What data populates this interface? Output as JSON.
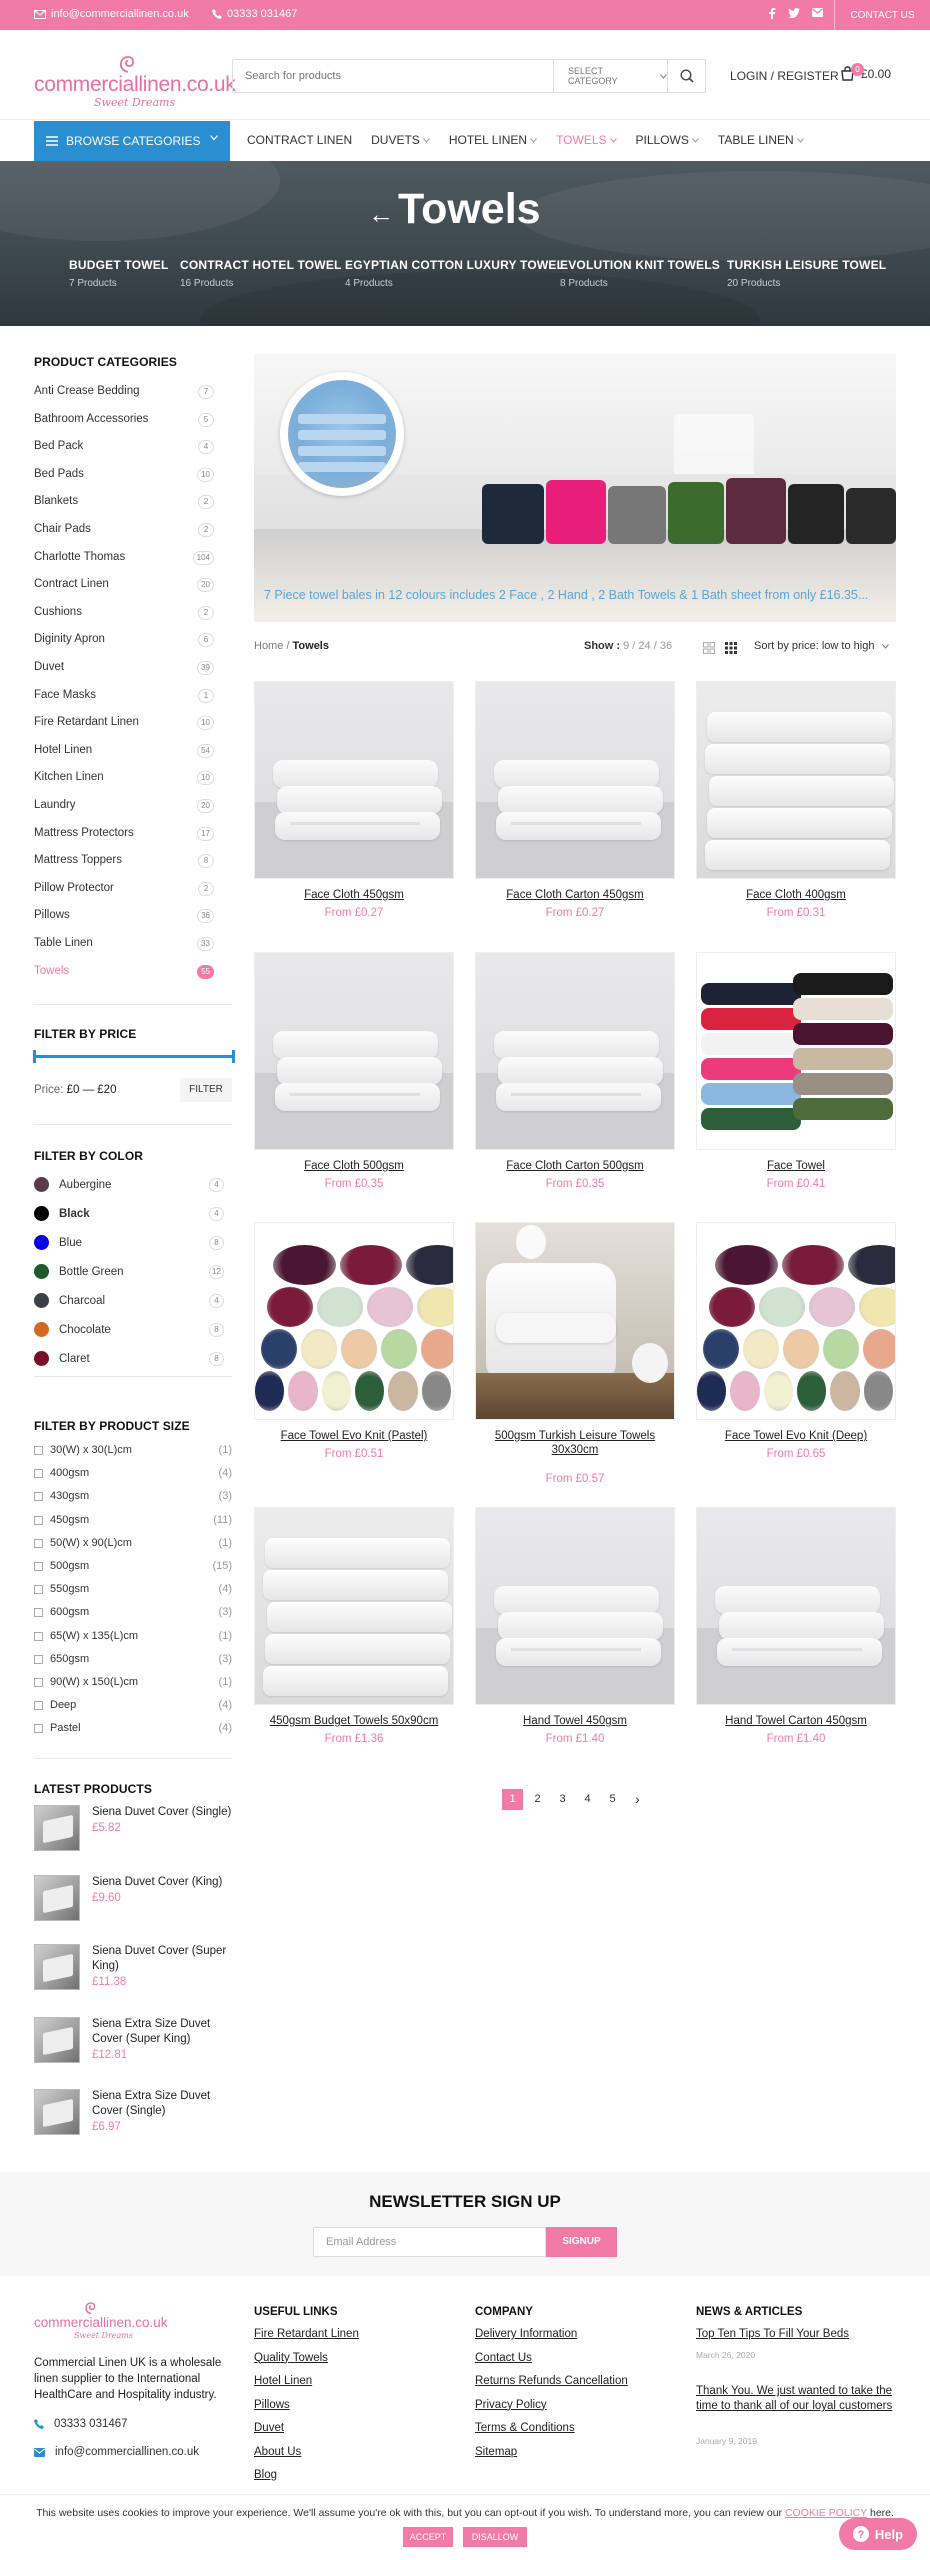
{
  "topbar": {
    "email": "info@commerciallinen.co.uk",
    "phone": "03333 031467",
    "contact": "CONTACT US",
    "social_icons": [
      "facebook-icon",
      "twitter-icon",
      "email-icon"
    ]
  },
  "header": {
    "logo_text": "commerciallinen.co.uk",
    "logo_tagline": "Sweet Dreams",
    "search_placeholder": "Search for products",
    "search_category": "SELECT CATEGORY",
    "login": "LOGIN / REGISTER",
    "cart_count": "0",
    "cart_total": "£0.00"
  },
  "nav": {
    "browse": "BROWSE CATEGORIES",
    "items": [
      {
        "label": "CONTRACT LINEN",
        "dropdown": false
      },
      {
        "label": "DUVETS",
        "dropdown": true
      },
      {
        "label": "HOTEL LINEN",
        "dropdown": true
      },
      {
        "label": "TOWELS",
        "dropdown": true,
        "active": true
      },
      {
        "label": "PILLOWS",
        "dropdown": true
      },
      {
        "label": "TABLE LINEN",
        "dropdown": true
      }
    ]
  },
  "hero": {
    "title": "Towels",
    "subcats": [
      {
        "title": "BUDGET TOWEL",
        "count": "7 Products"
      },
      {
        "title": "CONTRACT HOTEL TOWEL",
        "count": "16 Products"
      },
      {
        "title": "EGYPTIAN COTTON LUXURY TOWEL",
        "count": "4 Products"
      },
      {
        "title": "EVOLUTION KNIT TOWELS",
        "count": "8 Products"
      },
      {
        "title": "TURKISH LEISURE TOWEL",
        "count": "20 Products"
      }
    ]
  },
  "sidebar": {
    "categories_title": "PRODUCT CATEGORIES",
    "categories": [
      {
        "name": "Anti Crease Bedding",
        "count": "7"
      },
      {
        "name": "Bathroom Accessories",
        "count": "5"
      },
      {
        "name": "Bed Pack",
        "count": "4"
      },
      {
        "name": "Bed Pads",
        "count": "10"
      },
      {
        "name": "Blankets",
        "count": "2"
      },
      {
        "name": "Chair Pads",
        "count": "2"
      },
      {
        "name": "Charlotte Thomas",
        "count": "104"
      },
      {
        "name": "Contract Linen",
        "count": "20"
      },
      {
        "name": "Cushions",
        "count": "2"
      },
      {
        "name": "Diginity Apron",
        "count": "6"
      },
      {
        "name": "Duvet",
        "count": "39"
      },
      {
        "name": "Face Masks",
        "count": "1"
      },
      {
        "name": "Fire Retardant Linen",
        "count": "10"
      },
      {
        "name": "Hotel Linen",
        "count": "54"
      },
      {
        "name": "Kitchen Linen",
        "count": "10"
      },
      {
        "name": "Laundry",
        "count": "20"
      },
      {
        "name": "Mattress Protectors",
        "count": "17"
      },
      {
        "name": "Mattress Toppers",
        "count": "8"
      },
      {
        "name": "Pillow Protector",
        "count": "2"
      },
      {
        "name": "Pillows",
        "count": "36"
      },
      {
        "name": "Table Linen",
        "count": "33"
      },
      {
        "name": "Towels",
        "count": "55",
        "active": true
      }
    ],
    "price_title": "FILTER BY PRICE",
    "price_label": "Price:",
    "price_range": "£0 — £20",
    "price_button": "FILTER",
    "price_min": 0,
    "price_max": 20,
    "color_title": "FILTER BY COLOR",
    "colors": [
      {
        "name": "Aubergine",
        "count": "4",
        "hex": "#5b3a4e"
      },
      {
        "name": "Black",
        "count": "4",
        "hex": "#000000",
        "bold": true
      },
      {
        "name": "Blue",
        "count": "8",
        "hex": "#0000e6"
      },
      {
        "name": "Bottle Green",
        "count": "12",
        "hex": "#1f5a2b"
      },
      {
        "name": "Charcoal",
        "count": "4",
        "hex": "#3a3f48"
      },
      {
        "name": "Chocolate",
        "count": "8",
        "hex": "#d2691e"
      },
      {
        "name": "Claret",
        "count": "8",
        "hex": "#7a0f2a"
      }
    ],
    "size_title": "FILTER BY PRODUCT SIZE",
    "sizes": [
      {
        "name": "30(W) x 30(L)cm",
        "count": "(1)"
      },
      {
        "name": "400gsm",
        "count": "(4)"
      },
      {
        "name": "430gsm",
        "count": "(3)"
      },
      {
        "name": "450gsm",
        "count": "(11)"
      },
      {
        "name": "50(W) x 90(L)cm",
        "count": "(1)"
      },
      {
        "name": "500gsm",
        "count": "(15)"
      },
      {
        "name": "550gsm",
        "count": "(4)"
      },
      {
        "name": "600gsm",
        "count": "(3)"
      },
      {
        "name": "65(W) x 135(L)cm",
        "count": "(1)"
      },
      {
        "name": "650gsm",
        "count": "(3)"
      },
      {
        "name": "90(W) x 150(L)cm",
        "count": "(1)"
      },
      {
        "name": "Deep",
        "count": "(4)"
      },
      {
        "name": "Pastel",
        "count": "(4)"
      }
    ],
    "latest_title": "LATEST PRODUCTS",
    "latest": [
      {
        "name": "Siena Duvet Cover (Single)",
        "price": "£5.82"
      },
      {
        "name": "Siena Duvet Cover (King)",
        "price": "£9.60"
      },
      {
        "name": "Siena Duvet Cover (Super King)",
        "price": "£11.38"
      },
      {
        "name": "Siena Extra Size Duvet Cover (Super King)",
        "price": "£12.81"
      },
      {
        "name": "Siena Extra Size Duvet Cover (Single)",
        "price": "£6.97"
      }
    ]
  },
  "banner": {
    "caption": "7 Piece towel bales in 12 colours includes 2 Face , 2 Hand , 2 Bath Towels & 1 Bath sheet from only £16.35..."
  },
  "toolbar": {
    "breadcrumb_home": "Home",
    "breadcrumb_current": "Towels",
    "show_label": "Show :",
    "show_options": [
      "9",
      "24",
      "36"
    ],
    "sort": "Sort by price: low to high"
  },
  "products": [
    {
      "name": "Face Cloth 450gsm",
      "price": "From £0.27",
      "img": "white-stack"
    },
    {
      "name": "Face Cloth Carton 450gsm",
      "price": "From £0.27",
      "img": "white-stack"
    },
    {
      "name": "Face Cloth 400gsm",
      "price": "From £0.31",
      "img": "white-tall"
    },
    {
      "name": "Face Cloth 500gsm",
      "price": "From £0.35",
      "img": "white-stack"
    },
    {
      "name": "Face Cloth Carton 500gsm",
      "price": "From £0.35",
      "img": "white-stack"
    },
    {
      "name": "Face Towel",
      "price": "From £0.41",
      "img": "color-stacks"
    },
    {
      "name": "Face Towel Evo Knit (Pastel)",
      "price": "From £0.51",
      "img": "rolls"
    },
    {
      "name": "500gsm Turkish Leisure Towels 30x30cm",
      "price": "From £0.57",
      "img": "spa"
    },
    {
      "name": "Face Towel Evo Knit (Deep)",
      "price": "From £0.65",
      "img": "rolls"
    },
    {
      "name": "450gsm Budget Towels 50x90cm",
      "price": "From £1.36",
      "img": "white-tall"
    },
    {
      "name": "Hand Towel 450gsm",
      "price": "From £1.40",
      "img": "white-stack"
    },
    {
      "name": "Hand Towel Carton 450gsm",
      "price": "From £1.40",
      "img": "white-stack"
    }
  ],
  "pagination": [
    "1",
    "2",
    "3",
    "4",
    "5"
  ],
  "newsletter": {
    "title": "NEWSLETTER SIGN UP",
    "placeholder": "Email Address",
    "button": "SIGNUP"
  },
  "footer": {
    "logo_text": "commerciallinen.co.uk",
    "logo_tagline": "Sweet Dreams",
    "about": "Commercial Linen UK is a wholesale linen supplier to the International HealthCare and Hospitality industry.",
    "phone": "03333 031467",
    "email": "info@commerciallinen.co.uk",
    "useful_title": "USEFUL LINKS",
    "useful": [
      "Fire Retardant Linen",
      "Quality Towels",
      "Hotel Linen",
      "Pillows",
      "Duvet",
      "About Us",
      "Blog"
    ],
    "company_title": "COMPANY",
    "company": [
      "Delivery Information",
      "Contact Us",
      "Returns Refunds Cancellation",
      "Privacy Policy",
      "Terms & Conditions",
      "Sitemap"
    ],
    "articles_title": "NEWS & ARTICLES",
    "articles": [
      {
        "title": "Top Ten Tips To Fill Your Beds",
        "date": "March 26, 2020"
      },
      {
        "title": "Thank You. We just wanted to take the time to thank all of our loyal customers",
        "date": "January 9, 2019"
      }
    ]
  },
  "cookie": {
    "text": "This website uses cookies to improve your experience. We'll assume you're ok with this, but you can opt-out if you wish. To understand more, you can review our",
    "link": "COOKIE POLICY",
    "tail": "here.",
    "accept": "ACCEPT",
    "disallow": "DISALLOW"
  },
  "help": "Help",
  "colors": {
    "accent": "#f27aa6",
    "browse": "#2b8ed0",
    "hero": "#3e484f"
  }
}
